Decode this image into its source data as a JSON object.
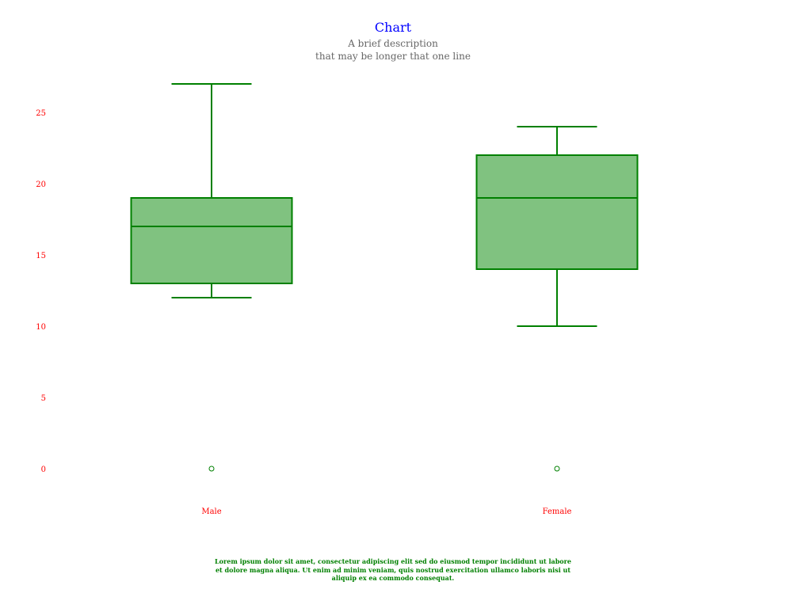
{
  "chart_data": {
    "type": "boxplot",
    "title": "Chart",
    "subtitle_lines": [
      "A brief description",
      "that may be longer that one line"
    ],
    "categories": [
      "Male",
      "Female"
    ],
    "boxes": [
      {
        "category": "Male",
        "min": 12,
        "q1": 13,
        "median": 17,
        "q3": 19,
        "max": 27,
        "outliers": [
          0
        ]
      },
      {
        "category": "Female",
        "min": 10,
        "q1": 14,
        "median": 19,
        "q3": 22,
        "max": 24,
        "outliers": [
          0
        ]
      }
    ],
    "y_ticks": [
      0,
      5,
      10,
      15,
      20,
      25
    ],
    "ylim": [
      0,
      27
    ],
    "grid": false,
    "footer_lines": [
      "Lorem ipsum dolor sit amet, consectetur adipiscing elit sed do eiusmod tempor incididunt ut labore",
      "et dolore magna aliqua. Ut enim ad minim veniam, quis nostrud exercitation ullamco laboris nisi ut",
      "aliquip ex ea commodo consequat."
    ]
  },
  "colors": {
    "title": "#0000ff",
    "subtitle": "#666666",
    "tick_labels": "#ff0000",
    "category_labels": "#ff0000",
    "box_fill": "#80c280",
    "box_stroke": "#008000",
    "footer": "#008000"
  }
}
